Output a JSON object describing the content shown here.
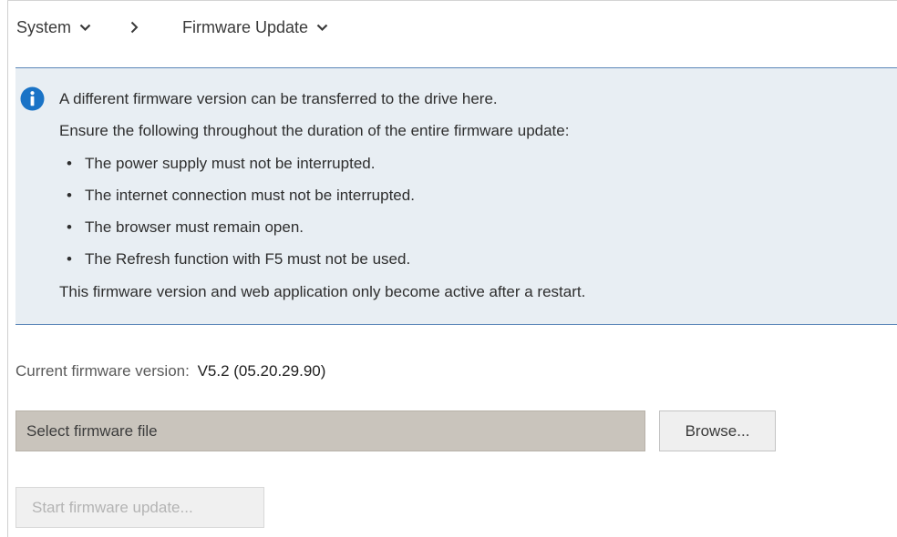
{
  "breadcrumb": {
    "system_label": "System",
    "page_label": "Firmware Update"
  },
  "info": {
    "line1": "A different firmware version can be transferred to the drive here.",
    "line2": "Ensure the following throughout the duration of the entire firmware update:",
    "bullets": [
      "The power supply must not be interrupted.",
      "The internet connection must not be interrupted.",
      "The browser must remain open.",
      "The Refresh function with F5 must not be used."
    ],
    "footer": "This firmware version and web application only become active after a restart."
  },
  "firmware": {
    "current_label": "Current firmware version:",
    "current_value": "V5.2 (05.20.29.90)"
  },
  "file_select": {
    "placeholder": "Select firmware file",
    "browse_label": "Browse..."
  },
  "actions": {
    "start_label": "Start firmware update..."
  },
  "colors": {
    "info_bg": "#e8eef3",
    "info_border": "#5b86b8",
    "info_icon": "#1a73c6",
    "file_field_bg": "#c9c4bc"
  },
  "icons": {
    "dropdown": "chevron-down-icon",
    "separator": "chevron-right-icon",
    "info": "info-icon"
  }
}
